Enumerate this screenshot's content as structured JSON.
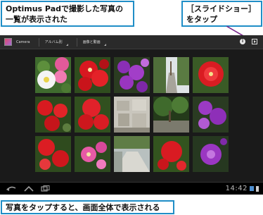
{
  "callouts": {
    "top_left_line1": "Optimus Padで撮影した写真の",
    "top_left_line2": "一覧が表示された",
    "top_right_line1": "［スライドショー］",
    "top_right_line2": "をタップ",
    "bottom": "写真をタップすると、画面全体で表示される"
  },
  "action_bar": {
    "app_title": "Camera",
    "dropdown_1": "アルバム別",
    "dropdown_2": "画像と動画",
    "info_icon": "info-icon",
    "slideshow_icon": "slideshow-icon"
  },
  "photos": [
    {
      "row": 1,
      "col": 1,
      "subject": "white-and-pink-flowers"
    },
    {
      "row": 1,
      "col": 2,
      "subject": "red-flowers"
    },
    {
      "row": 1,
      "col": 3,
      "subject": "purple-flowers"
    },
    {
      "row": 1,
      "col": 4,
      "subject": "tree-lined-path"
    },
    {
      "row": 1,
      "col": 5,
      "subject": "red-flower"
    },
    {
      "row": 2,
      "col": 1,
      "subject": "red-flowers"
    },
    {
      "row": 2,
      "col": 2,
      "subject": "red-flowers"
    },
    {
      "row": 2,
      "col": 3,
      "subject": "stone-wall"
    },
    {
      "row": 2,
      "col": 4,
      "subject": "garden-trees"
    },
    {
      "row": 2,
      "col": 5,
      "subject": "purple-flowers"
    },
    {
      "row": 3,
      "col": 1,
      "subject": "red-flowers"
    },
    {
      "row": 3,
      "col": 2,
      "subject": "pink-flowers"
    },
    {
      "row": 3,
      "col": 3,
      "subject": "walkway"
    },
    {
      "row": 3,
      "col": 4,
      "subject": "red-flowers"
    },
    {
      "row": 3,
      "col": 5,
      "subject": "purple-flower"
    }
  ],
  "system_bar": {
    "clock": "14:42",
    "back_icon": "back-icon",
    "home_icon": "home-icon",
    "recent_apps_icon": "recent-apps-icon"
  },
  "colors": {
    "callout_border": "#1f8ec7",
    "screen_background": "#1a1a1a",
    "action_bar": "#2a2a2a",
    "system_bar": "#000000"
  }
}
